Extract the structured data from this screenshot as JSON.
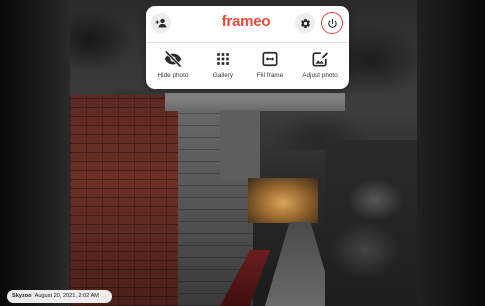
{
  "menu": {
    "brand": "frameo",
    "top_icons": {
      "left": "add-contact-icon",
      "settings": "gear-icon",
      "power": "power-icon"
    },
    "actions": [
      {
        "label": "Hide photo",
        "icon": "eye-off-icon"
      },
      {
        "label": "Gallery",
        "icon": "grid-icon"
      },
      {
        "label": "Fill frame",
        "icon": "fill-frame-icon"
      },
      {
        "label": "Adjust photo",
        "icon": "adjust-photo-icon"
      }
    ]
  },
  "caption": {
    "author": "Skyzoo",
    "date": "August 20, 2021, 2:02 AM"
  },
  "colors": {
    "brand_accent": "#ef4a39",
    "power_ring": "#e5413a",
    "icon_dark": "#2b2b2b"
  }
}
